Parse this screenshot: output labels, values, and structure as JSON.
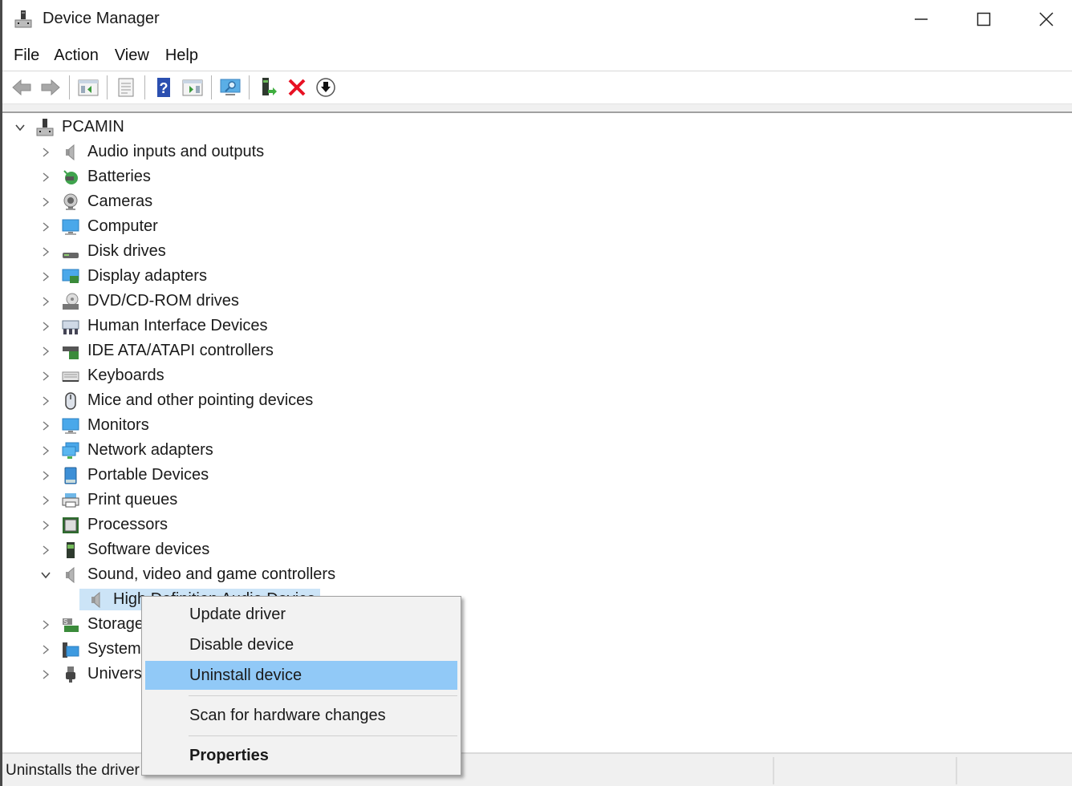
{
  "window": {
    "title": "Device Manager",
    "controls": {
      "minimize": "minimize-icon",
      "maximize": "maximize-icon",
      "close": "close-icon"
    }
  },
  "menubar": {
    "items": [
      {
        "label": "File"
      },
      {
        "label": "Action"
      },
      {
        "label": "View"
      },
      {
        "label": "Help"
      }
    ]
  },
  "toolbar": {
    "buttons": [
      {
        "icon": "back-arrow-icon"
      },
      {
        "icon": "forward-arrow-icon"
      },
      {
        "icon": "show-hide-console-tree-icon"
      },
      {
        "icon": "properties-icon"
      },
      {
        "icon": "help-icon"
      },
      {
        "icon": "show-hide-action-pane-icon"
      },
      {
        "icon": "scan-hardware-icon"
      },
      {
        "icon": "update-driver-icon"
      },
      {
        "icon": "uninstall-device-icon"
      },
      {
        "icon": "enable-device-icon"
      }
    ]
  },
  "tree": {
    "root": {
      "label": "PCAMIN",
      "icon": "computer-root-icon",
      "expanded": true
    },
    "categories": [
      {
        "label": "Audio inputs and outputs",
        "icon": "speaker-icon",
        "expanded": false
      },
      {
        "label": "Batteries",
        "icon": "battery-icon",
        "expanded": false
      },
      {
        "label": "Cameras",
        "icon": "camera-icon",
        "expanded": false
      },
      {
        "label": "Computer",
        "icon": "monitor-icon",
        "expanded": false
      },
      {
        "label": "Disk drives",
        "icon": "disk-drive-icon",
        "expanded": false
      },
      {
        "label": "Display adapters",
        "icon": "display-adapter-icon",
        "expanded": false
      },
      {
        "label": "DVD/CD-ROM drives",
        "icon": "dvd-drive-icon",
        "expanded": false
      },
      {
        "label": "Human Interface Devices",
        "icon": "hid-icon",
        "expanded": false
      },
      {
        "label": "IDE ATA/ATAPI controllers",
        "icon": "ide-controller-icon",
        "expanded": false
      },
      {
        "label": "Keyboards",
        "icon": "keyboard-icon",
        "expanded": false
      },
      {
        "label": "Mice and other pointing devices",
        "icon": "mouse-icon",
        "expanded": false
      },
      {
        "label": "Monitors",
        "icon": "monitor-icon",
        "expanded": false
      },
      {
        "label": "Network adapters",
        "icon": "network-adapter-icon",
        "expanded": false
      },
      {
        "label": "Portable Devices",
        "icon": "portable-device-icon",
        "expanded": false
      },
      {
        "label": "Print queues",
        "icon": "printer-icon",
        "expanded": false
      },
      {
        "label": "Processors",
        "icon": "processor-icon",
        "expanded": false
      },
      {
        "label": "Software devices",
        "icon": "software-device-icon",
        "expanded": false
      },
      {
        "label": "Sound, video and game controllers",
        "icon": "speaker-icon",
        "expanded": true,
        "children": [
          {
            "label": "High Definition Audio Device",
            "icon": "speaker-icon",
            "selected": true
          }
        ]
      },
      {
        "label": "Storage controllers",
        "icon": "storage-controller-icon",
        "expanded": false
      },
      {
        "label": "System devices",
        "icon": "system-device-icon",
        "expanded": false
      },
      {
        "label": "Universal Serial Bus controllers",
        "icon": "usb-icon",
        "expanded": false
      }
    ]
  },
  "context_menu": {
    "items": [
      {
        "label": "Update driver",
        "highlighted": false,
        "bold": false
      },
      {
        "label": "Disable device",
        "highlighted": false,
        "bold": false
      },
      {
        "label": "Uninstall device",
        "highlighted": true,
        "bold": false
      },
      {
        "label": "Scan for hardware changes",
        "highlighted": false,
        "bold": false
      },
      {
        "label": "Properties",
        "highlighted": false,
        "bold": true
      }
    ]
  },
  "statusbar": {
    "text": "Uninstalls the driver for the selected device."
  },
  "colors": {
    "menu_highlight": "#91c9f7",
    "selection": "#cce4f7",
    "uninstall_red": "#e81123",
    "help_blue": "#2b4fb0"
  }
}
